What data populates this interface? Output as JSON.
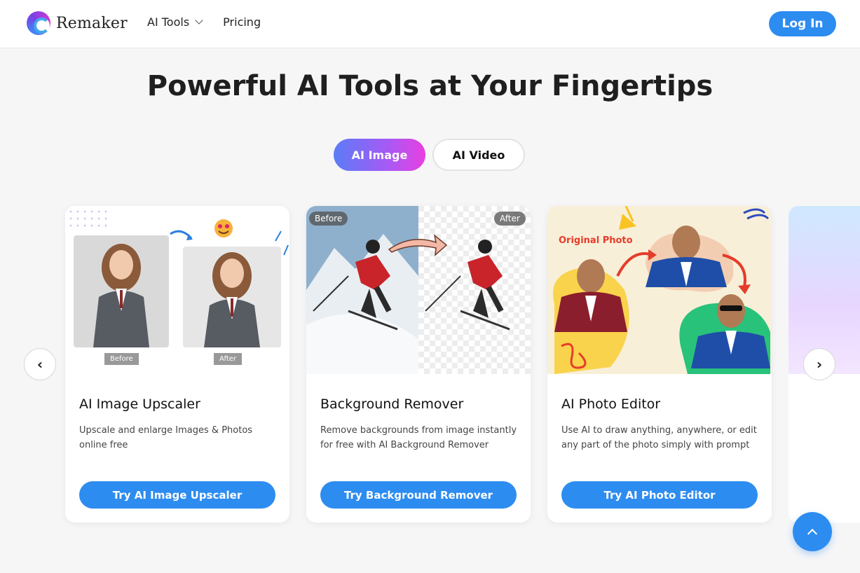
{
  "header": {
    "brand": "Remaker",
    "nav": [
      {
        "label": "AI Tools",
        "has_dropdown": true
      },
      {
        "label": "Pricing"
      }
    ],
    "login_label": "Log In"
  },
  "page_title": "Powerful AI Tools at Your Fingertips",
  "tabs": [
    {
      "label": "AI Image",
      "active": true
    },
    {
      "label": "AI Video",
      "active": false
    }
  ],
  "cards": [
    {
      "title": "AI Image Upscaler",
      "description": "Upscale and enlarge Images & Photos online free",
      "button": "Try AI Image Upscaler",
      "image_labels": [
        "Before",
        "After"
      ]
    },
    {
      "title": "Background Remover",
      "description": "Remove backgrounds from image instantly for free with AI Background Remover",
      "button": "Try Background Remover",
      "image_labels": [
        "Before",
        "After"
      ]
    },
    {
      "title": "AI Photo Editor",
      "description": "Use AI to draw anything, anywhere, or edit any part of the photo simply with prompt",
      "button": "Try AI Photo Editor",
      "image_labels": [
        "Original Photo"
      ]
    }
  ],
  "carousel": {
    "prev": "‹",
    "next": "›"
  },
  "colors": {
    "primary": "#2d8cf0",
    "tab_gradient_start": "#5b7cf7",
    "tab_gradient_end": "#e93fe0"
  }
}
